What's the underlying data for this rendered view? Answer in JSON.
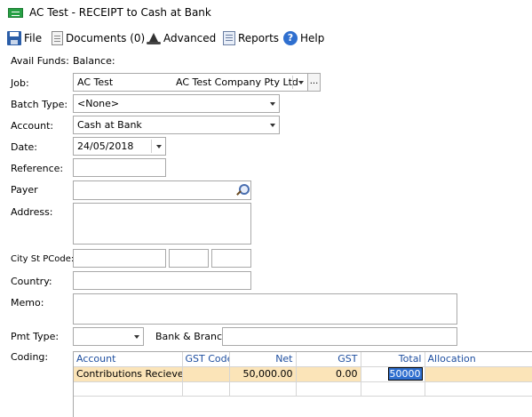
{
  "window": {
    "title": "AC Test - RECEIPT to Cash at Bank"
  },
  "toolbar": {
    "file": "File",
    "documents": "Documents (0)",
    "advanced": "Advanced",
    "reports": "Reports",
    "help": "Help"
  },
  "form": {
    "avail_funds_label": "Avail Funds:",
    "balance_label": "Balance:",
    "job_label": "Job:",
    "job_code": "AC Test",
    "job_name": "AC Test Company Pty Ltd",
    "batch_type_label": "Batch Type:",
    "batch_type_value": "<None>",
    "account_label": "Account:",
    "account_value": "Cash at Bank",
    "date_label": "Date:",
    "date_value": "24/05/2018",
    "reference_label": "Reference:",
    "reference_value": "",
    "payer_label": "Payer",
    "payer_value": "",
    "address_label": "Address:",
    "address_value": "",
    "city_label": "City St PCode:",
    "city_value": "",
    "state_value": "",
    "pcode_value": "",
    "country_label": "Country:",
    "country_value": "",
    "memo_label": "Memo:",
    "memo_value": "",
    "pmt_type_label": "Pmt Type:",
    "pmt_type_value": "",
    "bank_branch_label": "Bank & Branch:",
    "bank_branch_value": "",
    "coding_label": "Coding:",
    "ellipsis": "..."
  },
  "coding": {
    "headers": {
      "account": "Account",
      "gst_code": "GST Code",
      "net": "Net",
      "gst": "GST",
      "total": "Total",
      "allocation": "Allocation"
    },
    "rows": [
      {
        "account": "Contributions Recieved",
        "gst_code": "",
        "net": "50,000.00",
        "gst": "0.00",
        "total": "50000",
        "allocation": ""
      }
    ]
  },
  "colors": {
    "header_text": "#1f4fa0",
    "row_highlight": "#fbe4b8",
    "selection": "#2f6fcf"
  },
  "icons": {
    "title": "receipt-icon",
    "file": "save-icon",
    "documents": "document-icon",
    "advanced": "wizard-hat-icon",
    "reports": "report-icon",
    "help": "help-icon",
    "payer_search": "search-icon"
  }
}
